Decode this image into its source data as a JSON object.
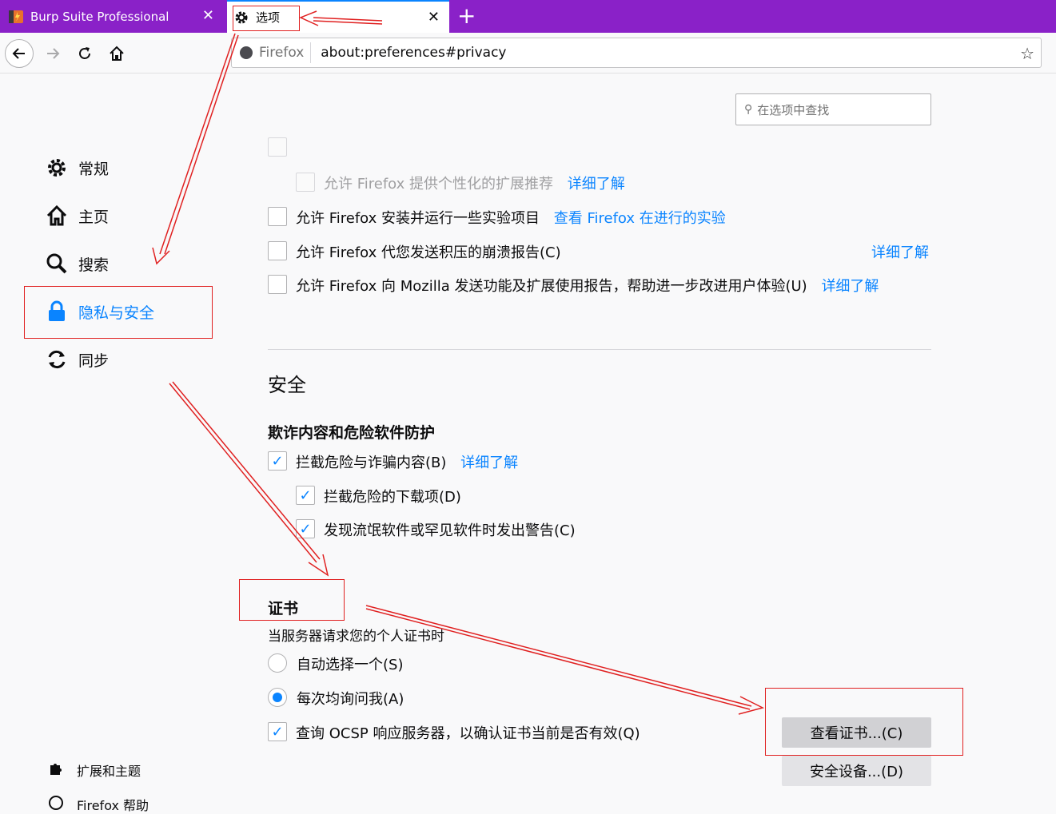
{
  "tabs": [
    {
      "title": "Burp Suite Professional",
      "close": "✕"
    },
    {
      "title": "选项",
      "close": "✕"
    }
  ],
  "new_tab": "+",
  "urlbar": {
    "identity": "Firefox",
    "url": "about:preferences#privacy"
  },
  "search": {
    "placeholder": "在选项中查找"
  },
  "sidebar": {
    "items": [
      {
        "label": "常规",
        "icon": "gear-icon"
      },
      {
        "label": "主页",
        "icon": "home-icon"
      },
      {
        "label": "搜索",
        "icon": "search-icon"
      },
      {
        "label": "隐私与安全",
        "icon": "lock-icon"
      },
      {
        "label": "同步",
        "icon": "sync-icon"
      }
    ],
    "footer": [
      {
        "label": "扩展和主题",
        "icon": "puzzle-icon"
      },
      {
        "label": "Firefox 帮助",
        "icon": "help-icon"
      }
    ]
  },
  "data_collection": {
    "recommend": {
      "label": "允许 Firefox 提供个性化的扩展推荐",
      "link": "详细了解"
    },
    "studies": {
      "label": "允许 Firefox 安装并运行一些实验项目",
      "link": "查看 Firefox 在进行的实验"
    },
    "crash": {
      "label": "允许 Firefox 代您发送积压的崩溃报告(C)",
      "link": "详细了解"
    },
    "telemetry": {
      "label": "允许 Firefox 向 Mozilla 发送功能及扩展使用报告，帮助进一步改进用户体验(U)",
      "link": "详细了解"
    }
  },
  "security": {
    "heading": "安全",
    "protection": {
      "heading": "欺诈内容和危险软件防护",
      "block_dangerous": {
        "label": "拦截危险与诈骗内容(B)",
        "link": "详细了解"
      },
      "block_downloads": {
        "label": "拦截危险的下载项(D)"
      },
      "warn_unwanted": {
        "label": "发现流氓软件或罕见软件时发出警告(C)"
      }
    },
    "certificates": {
      "heading": "证书",
      "description": "当服务器请求您的个人证书时",
      "auto_select": "自动选择一个(S)",
      "ask_every_time": "每次均询问我(A)",
      "ocsp": "查询 OCSP 响应服务器，以确认证书当前是否有效(Q)",
      "view_button": "查看证书...(C)",
      "devices_button": "安全设备...(D)"
    }
  },
  "colors": {
    "accent": "#0a84ff",
    "tabbar": "#8a21c8",
    "annotation": "#e02020"
  }
}
